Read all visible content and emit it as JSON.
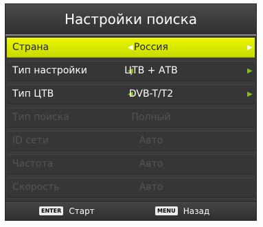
{
  "title": "Настройки поиска",
  "rows": [
    {
      "label": "Страна",
      "value": "Россия",
      "state": "selected"
    },
    {
      "label": "Тип настройки",
      "value": "ЦТВ + АТВ",
      "state": "normal"
    },
    {
      "label": "Тип ЦТВ",
      "value": "DVB-T/T2",
      "state": "normal"
    },
    {
      "label": "Тип поиска",
      "value": "Полный",
      "state": "disabled"
    },
    {
      "label": "ID сети",
      "value": "Авто",
      "state": "disabled"
    },
    {
      "label": "Частота",
      "value": "Авто",
      "state": "disabled"
    },
    {
      "label": "Скорость",
      "value": "Авто",
      "state": "disabled"
    }
  ],
  "footer": {
    "enter_key": "ENTER",
    "enter_label": "Старт",
    "menu_key": "MENU",
    "menu_label": "Назад"
  },
  "colors": {
    "selected_row": "#d6e600",
    "arrow": "#86c21a",
    "panel": "#3a3a3a",
    "disabled_text": "#555555"
  },
  "icons": {
    "left_arrow": "triangle-left-icon",
    "right_arrow": "triangle-right-icon"
  }
}
